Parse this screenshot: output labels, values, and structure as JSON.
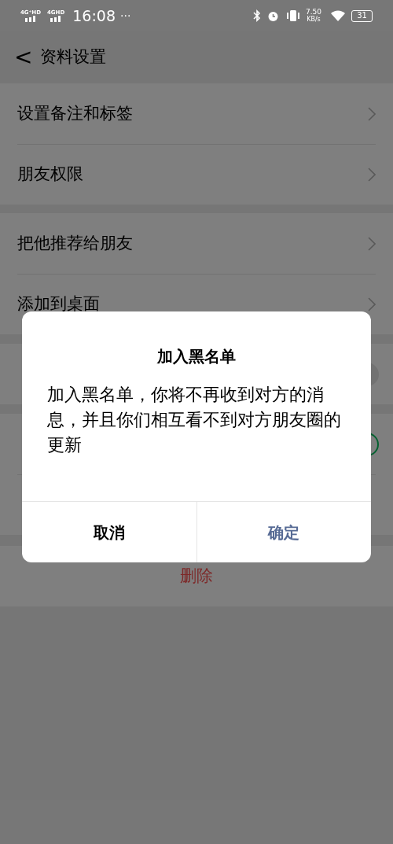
{
  "status_bar": {
    "networks": [
      "4G⁺HD",
      "4GHD"
    ],
    "time": "16:08",
    "more": "···",
    "speed": "7.50",
    "speed_unit": "KB/s",
    "battery": "31"
  },
  "header": {
    "back": "<",
    "title": "资料设置"
  },
  "sections": [
    {
      "items": [
        {
          "kind": "link",
          "label": "设置备注和标签"
        },
        {
          "kind": "link",
          "label": "朋友权限"
        }
      ]
    },
    {
      "items": [
        {
          "kind": "link",
          "label": "把他推荐给朋友"
        },
        {
          "kind": "link",
          "label": "添加到桌面"
        }
      ]
    },
    {
      "items": [
        {
          "kind": "switch",
          "on": false
        }
      ]
    },
    {
      "items": [
        {
          "kind": "switch",
          "on": true
        },
        {
          "kind": "plain"
        }
      ]
    }
  ],
  "delete_button": "删除",
  "dialog": {
    "title": "加入黑名单",
    "message": "加入黑名单，你将不再收到对方的消息，并且你们相互看不到对方朋友圈的更新",
    "cancel": "取消",
    "confirm": "确定"
  }
}
